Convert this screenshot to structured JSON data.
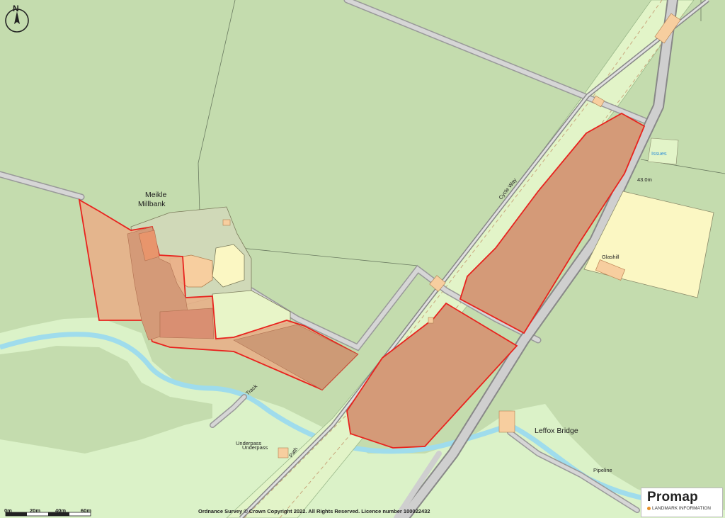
{
  "labels": {
    "meikle": "Meikle",
    "millbank": "Millbank",
    "cycle_way": "Cycle Way",
    "issues": "Issues",
    "elevation": "43.0m",
    "glashill": "Glashill",
    "track": "Track",
    "underpass_1": "Underpass",
    "underpass_2": "Underpass",
    "path": "Path",
    "leffox_bridge": "Leffox Bridge",
    "pipeline": "Pipeline"
  },
  "north": "N",
  "copyright": "Ordnance Survey © Crown Copyright 2022. All Rights Reserved. Licence number 100022432",
  "scale": {
    "ticks": [
      "0m",
      "20m",
      "40m",
      "60m"
    ]
  },
  "logo": {
    "name": "Promap",
    "tagline": "LANDMARK INFORMATION",
    "accent": "#e8902a"
  },
  "colors": {
    "field": "#c4dcae",
    "verge": "#e2f4c8",
    "road": "#b4b4b4",
    "water": "#bfe9f3",
    "site_fill": "#d49a78",
    "site_border": "#e8231e",
    "building": "#f7ce9f"
  }
}
